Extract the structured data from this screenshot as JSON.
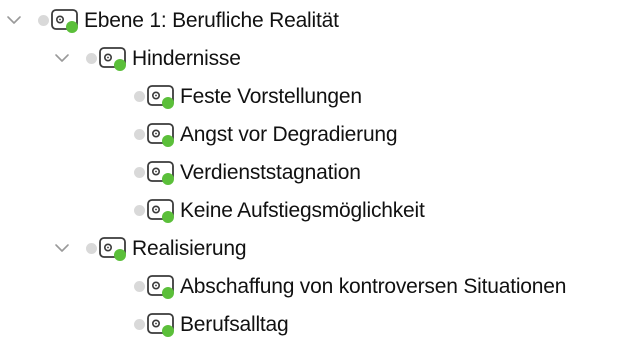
{
  "colors": {
    "chevron": "#9a9a9a",
    "bullet_dot": "#d9d9d9",
    "icon_outline": "#3a3a3a",
    "icon_green": "#5bbf3a",
    "text": "#111111"
  },
  "icons": {
    "chevron": "chevron-down-icon",
    "bullet": "bullet-dot-icon",
    "code": "code-tag-icon"
  },
  "tree": {
    "root": {
      "label": "Ebene 1: Berufliche Realität",
      "expanded": true,
      "children": [
        {
          "label": "Hindernisse",
          "expanded": true,
          "children": [
            {
              "label": "Feste Vorstellungen"
            },
            {
              "label": "Angst vor Degradierung"
            },
            {
              "label": "Verdienststagnation"
            },
            {
              "label": "Keine Aufstiegsmöglichkeit"
            }
          ]
        },
        {
          "label": "Realisierung",
          "expanded": true,
          "children": [
            {
              "label": "Abschaffung von kontroversen Situationen"
            },
            {
              "label": "Berufsalltag"
            }
          ]
        }
      ]
    }
  }
}
